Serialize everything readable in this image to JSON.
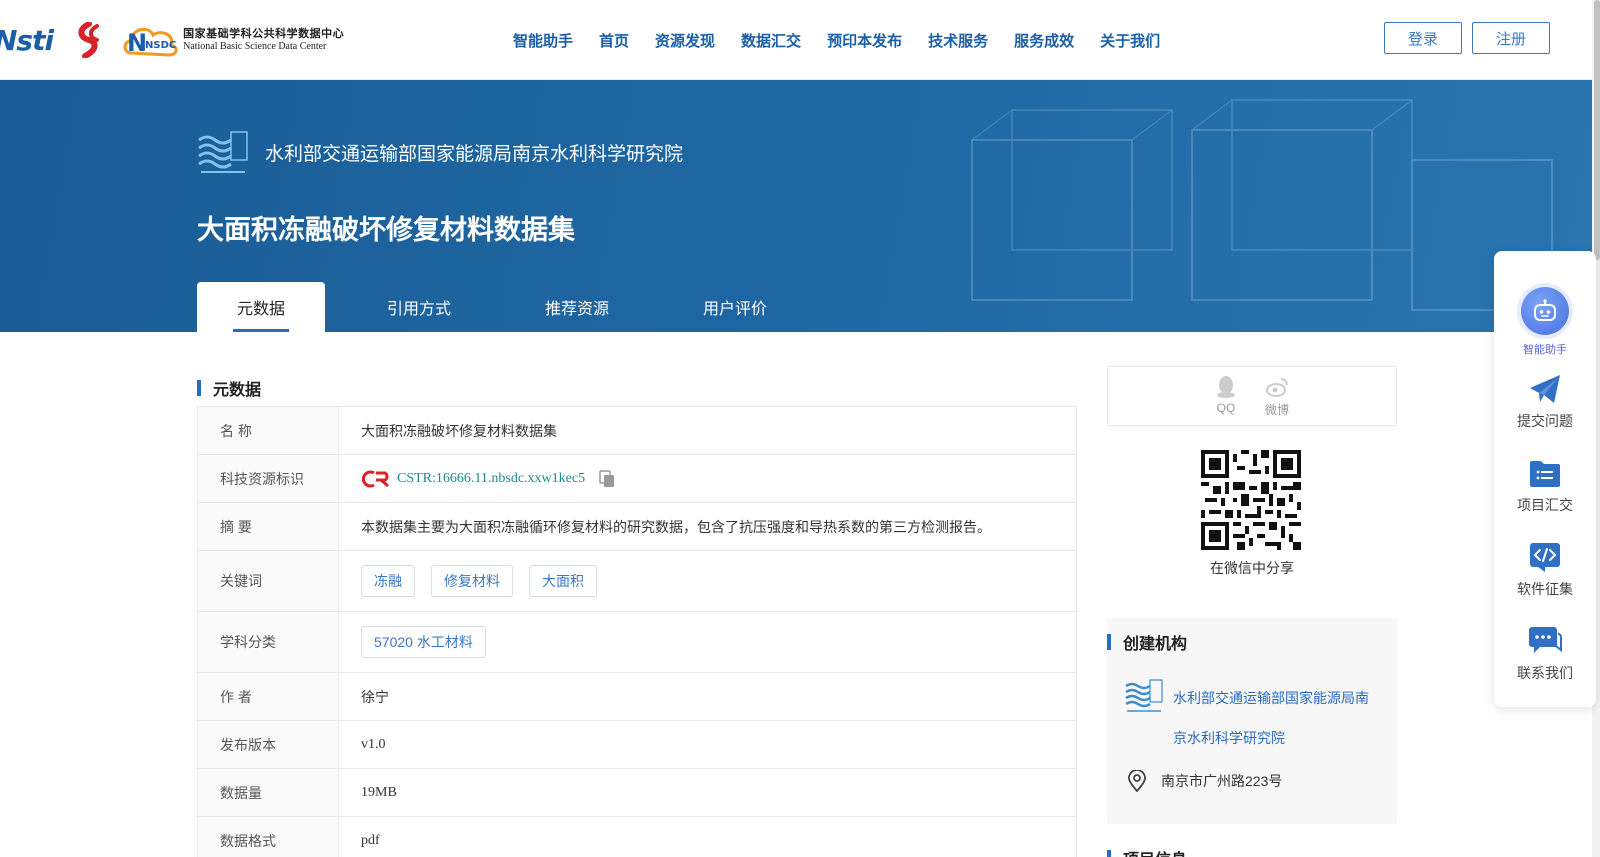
{
  "header": {
    "logo_nsti": "Nsti",
    "logo_nsdc_badge": "NSDC",
    "logo_nsdc_cn": "国家基础学科公共科学数据中心",
    "logo_nsdc_en": "National Basic Science Data Center",
    "nav": [
      "智能助手",
      "首页",
      "资源发现",
      "数据汇交",
      "预印本发布",
      "技术服务",
      "服务成效",
      "关于我们"
    ],
    "login": "登录",
    "register": "注册"
  },
  "banner": {
    "institution": "水利部交通运输部国家能源局南京水利科学研究院",
    "title": "大面积冻融破坏修复材料数据集",
    "tabs": [
      "元数据",
      "引用方式",
      "推荐资源",
      "用户评价"
    ],
    "active_tab": "元数据"
  },
  "metadata": {
    "section_title": "元数据",
    "rows": {
      "name": {
        "label": "名  称",
        "value": "大面积冻融破坏修复材料数据集"
      },
      "cstr": {
        "label": "科技资源标识",
        "value": "CSTR:16666.11.nbsdc.xxw1kec5"
      },
      "abstract": {
        "label": "摘  要",
        "value": "本数据集主要为大面积冻融循环修复材料的研究数据，包含了抗压强度和导热系数的第三方检测报告。"
      },
      "keywords": {
        "label": "关键词",
        "values": [
          "冻融",
          "修复材料",
          "大面积"
        ]
      },
      "subject": {
        "label": "学科分类",
        "value": "57020 水工材料"
      },
      "author": {
        "label": "作  者",
        "value": "徐宁"
      },
      "version": {
        "label": "发布版本",
        "value": "v1.0"
      },
      "size": {
        "label": "数据量",
        "value": "19MB"
      },
      "format": {
        "label": "数据格式",
        "value": "pdf"
      }
    }
  },
  "share": {
    "qq": "QQ",
    "weibo": "微博",
    "wechat_caption": "在微信中分享"
  },
  "org": {
    "title": "创建机构",
    "name": "水利部交通运输部国家能源局南京水利科学研究院",
    "address": "南京市广州路223号"
  },
  "project": {
    "title": "项目信息"
  },
  "side_panel": {
    "assistant": "智能助手",
    "submit_issue": "提交问题",
    "project_collect": "项目汇交",
    "software_collect": "软件征集",
    "contact": "联系我们"
  },
  "colors": {
    "brand": "#1a5fa8",
    "banner": "#1f68a5",
    "accent": "#2a6bc1",
    "link_teal": "#1b8c8c"
  }
}
